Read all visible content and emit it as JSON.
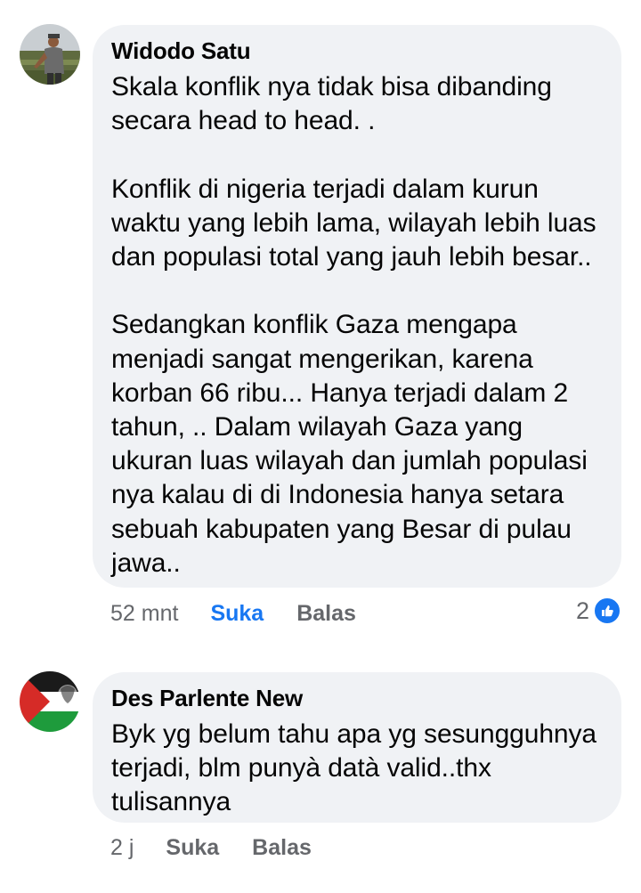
{
  "comments": [
    {
      "author": "Widodo Satu",
      "text": "Skala konflik nya tidak bisa dibanding\nsecara head to head. .\n\nKonflik di nigeria terjadi dalam kurun\nwaktu yang lebih lama, wilayah lebih luas\ndan populasi total yang jauh lebih besar..\n\nSedangkan konflik Gaza mengapa\nmenjadi sangat mengerikan, karena\nkorban 66 ribu... Hanya terjadi dalam 2\ntahun, .. Dalam wilayah Gaza yang\nukuran luas wilayah dan jumlah populasi\nnya kalau di di Indonesia hanya setara\nsebuah kabupaten yang Besar di pulau\njawa..",
      "time": "52 mnt",
      "like_label": "Suka",
      "reply_label": "Balas",
      "reaction_count": "2",
      "reaction_icon": "like-icon",
      "like_color": "#1877f2"
    },
    {
      "author": "Des Parlente New",
      "text": "Byk yg belum tahu apa yg sesungguhnya\nterjadi, blm punyà datà valid..thx\ntulisannya",
      "time": "2 j",
      "like_label": "Suka",
      "reply_label": "Balas"
    }
  ],
  "colors": {
    "bubble": "#f0f2f5",
    "meta_text": "#65676b",
    "accent": "#1877f2"
  }
}
